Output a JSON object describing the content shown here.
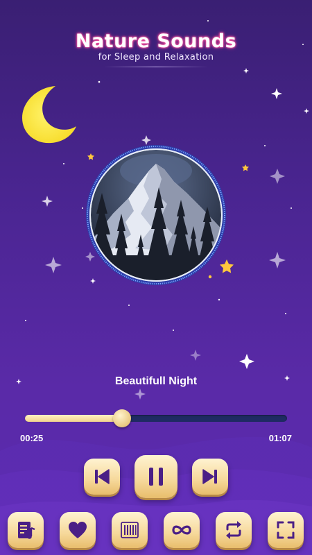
{
  "header": {
    "title": "Nature Sounds",
    "subtitle": "for Sleep and Relaxation"
  },
  "player": {
    "track_title": "Beautifull Night",
    "elapsed": "00:25",
    "total": "01:07",
    "progress_fraction": 0.37
  },
  "controls": {
    "transport": [
      {
        "name": "previous-button",
        "icon": "skip-previous-icon"
      },
      {
        "name": "pause-button",
        "icon": "pause-icon"
      },
      {
        "name": "next-button",
        "icon": "skip-next-icon"
      }
    ],
    "bottom_bar": [
      {
        "name": "playlist-button",
        "icon": "music-note-list-icon"
      },
      {
        "name": "favorite-button",
        "icon": "heart-icon"
      },
      {
        "name": "equalizer-button",
        "icon": "bars-icon"
      },
      {
        "name": "infinite-loop-button",
        "icon": "infinity-icon"
      },
      {
        "name": "repeat-button",
        "icon": "repeat-icon"
      },
      {
        "name": "fullscreen-button",
        "icon": "fullscreen-icon"
      }
    ]
  },
  "colors": {
    "background_top": "#3a1f73",
    "background_bottom": "#5b2bb0",
    "accent_gold": "#f6d89a",
    "icon_purple": "#4a1f86",
    "moon_yellow": "#fce94a",
    "title_glow": "#ff5fa8",
    "progress_track": "#1f2b63"
  }
}
